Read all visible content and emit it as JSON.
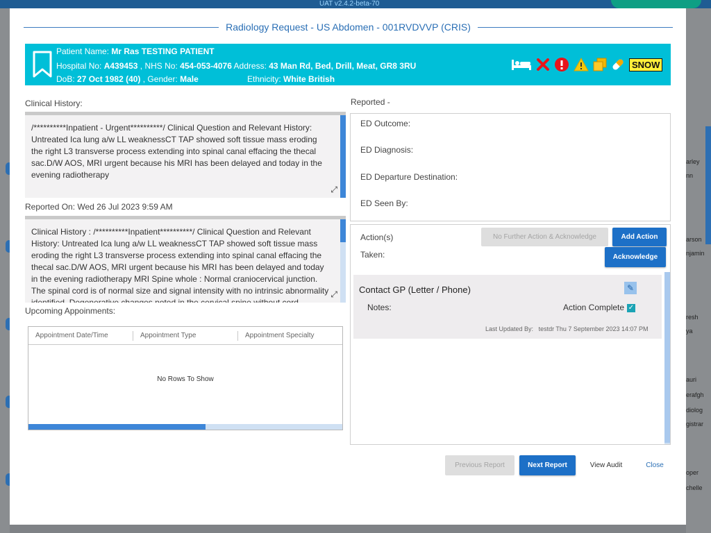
{
  "background": {
    "version": "UAT v2.4.2-beta-70",
    "right_names": [
      "arley",
      "nn",
      "arson",
      "njamin",
      "resh",
      "ya",
      "auri",
      "erafgh",
      "diolog",
      "gistrar",
      "oper",
      "chelle"
    ]
  },
  "modal": {
    "title": "Radiology Request - US Abdomen - 001RVDVVP (CRIS)"
  },
  "patient": {
    "name_label": "Patient Name:",
    "name": "Mr Ras TESTING PATIENT",
    "hospital_label": "Hospital No:",
    "hospital_no": "A439453",
    "nhs_label": ", NHS No:",
    "nhs_no": "454-053-4076",
    "address_label": "Address:",
    "address": "43 Man Rd, Bed, Drill, Meat, GR8 3RU",
    "dob_label": "DoB:",
    "dob": "27 Oct 1982 (40)",
    "gender_label": ", Gender:",
    "gender": "Male",
    "ethnicity_label": "Ethnicity:",
    "ethnicity": "White British",
    "badge": "SNOW",
    "icons": [
      "bed-icon",
      "cross-icon",
      "alert-icon",
      "warning-icon",
      "copy-icon",
      "pill-icon"
    ],
    "colors": {
      "banner": "#00bfd8"
    }
  },
  "clinical": {
    "label": "Clinical History:",
    "text": "/**********Inpatient - Urgent**********/ Clinical Question and Relevant History: Untreated Ica lung a/w LL weaknessCT TAP showed soft tissue mass eroding the right L3 transverse process extending into spinal canal effacing the thecal sac.D/W AOS, MRI urgent because his MRI has been delayed and today in the evening radiotherapy"
  },
  "reported_on": "Reported On: Wed 26 Jul 2023 9:59 AM",
  "report": {
    "text": "Clinical History : /**********Inpatient**********/ Clinical Question and Relevant History: Untreated Ica lung a/w LL weaknessCT TAP showed soft tissue mass eroding the right L3 transverse process extending into spinal canal effacing the thecal sac.D/W AOS, MRI urgent because his MRI has been delayed and today in the evening radiotherapy  MRI Spine whole : Normal craniocervical junction. The spinal cord is of normal size and signal intensity with no intrinsic abnormality identified. Degenerative changes noted in the cervical spine without cord"
  },
  "appointments": {
    "label": "Upcoming Appoinments:",
    "columns": [
      "Appointment Date/Time",
      "Appointment Type",
      "Appointment Specialty"
    ],
    "empty": "No Rows To Show"
  },
  "reported_label": "Reported -",
  "ed": {
    "outcome": "ED Outcome:",
    "diagnosis": "ED Diagnosis:",
    "destination": "ED Departure Destination:",
    "seen_by": "ED Seen By:"
  },
  "actions": {
    "label": "Action(s)",
    "taken": "Taken:",
    "no_further": "No Further Action & Acknowledge",
    "add": "Add Action",
    "acknowledge": "Acknowledge",
    "item": {
      "title": "Contact GP (Letter / Phone)",
      "notes": "Notes:",
      "complete": "Action Complete",
      "updated_label": "Last Updated By:",
      "updated_value": "testdr Thu 7 September 2023 14:07 PM"
    }
  },
  "footer": {
    "previous": "Previous Report",
    "next": "Next Report",
    "audit": "View Audit",
    "close": "Close"
  }
}
